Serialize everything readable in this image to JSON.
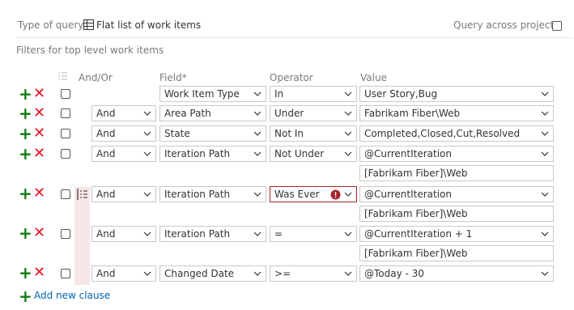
{
  "query": {
    "type_label": "Type of query",
    "type_value": "Flat list of work items",
    "across_label": "Query across projects",
    "filters_label": "Filters for top level work items"
  },
  "headers": {
    "andor": "And/Or",
    "field": "Field*",
    "operator": "Operator",
    "value": "Value"
  },
  "rows": [
    {
      "andor": "",
      "field": "Work Item Type",
      "operator": "In",
      "value": "User Story,Bug",
      "extra": ""
    },
    {
      "andor": "And",
      "field": "Area Path",
      "operator": "Under",
      "value": "Fabrikam Fiber\\Web",
      "extra": ""
    },
    {
      "andor": "And",
      "field": "State",
      "operator": "Not In",
      "value": "Completed,Closed,Cut,Resolved",
      "extra": ""
    },
    {
      "andor": "And",
      "field": "Iteration Path",
      "operator": "Not Under",
      "value": "@CurrentIteration",
      "extra": "[Fabrikam Fiber]\\Web"
    },
    {
      "andor": "And",
      "field": "Iteration Path",
      "operator": "Was Ever",
      "value": "@CurrentIteration",
      "extra": "[Fabrikam Fiber]\\Web"
    },
    {
      "andor": "And",
      "field": "Iteration Path",
      "operator": "=",
      "value": "@CurrentIteration + 1",
      "extra": "[Fabrikam Fiber]\\Web"
    },
    {
      "andor": "And",
      "field": "Changed Date",
      "operator": ">=",
      "value": "@Today - 30",
      "extra": ""
    }
  ],
  "add_clause": "Add new clause",
  "colors": {
    "add": "#107c10",
    "remove": "#e81123",
    "error": "#a4262c",
    "link": "#0063b1"
  }
}
